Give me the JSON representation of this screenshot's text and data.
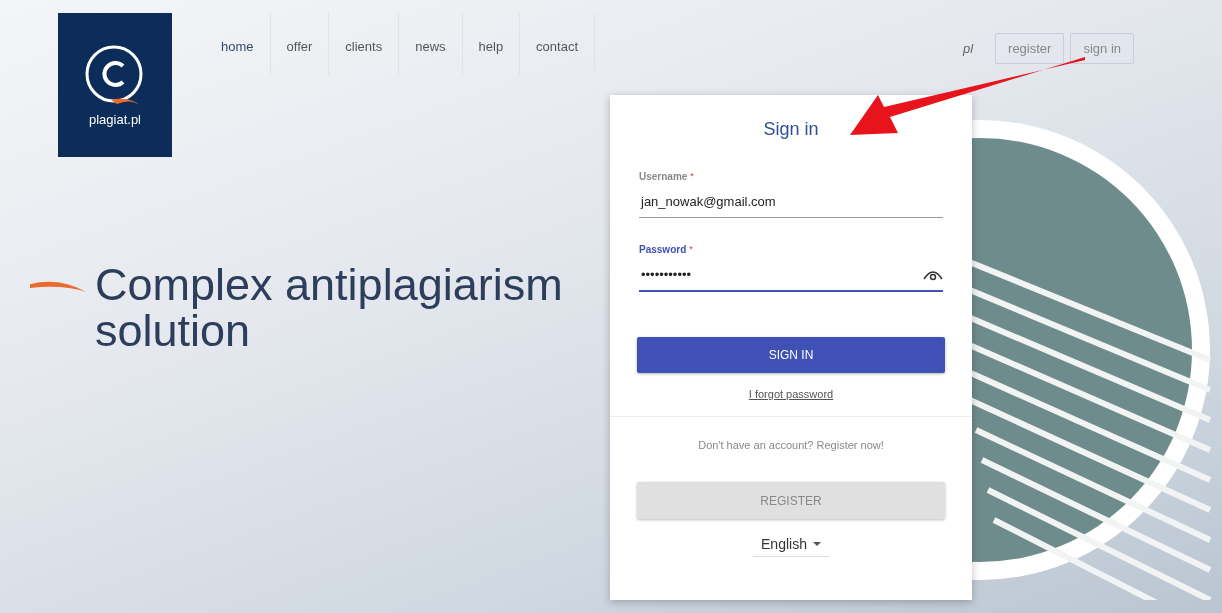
{
  "logo": {
    "text": "plagiat.pl"
  },
  "nav": [
    {
      "label": "home",
      "selected": true
    },
    {
      "label": "offer",
      "selected": false
    },
    {
      "label": "clients",
      "selected": false
    },
    {
      "label": "news",
      "selected": false
    },
    {
      "label": "help",
      "selected": false
    },
    {
      "label": "contact",
      "selected": false
    }
  ],
  "header_actions": {
    "language": "pl",
    "buttons": [
      "register",
      "sign in"
    ]
  },
  "hero": {
    "headline": "Complex antiplagiarism solution"
  },
  "sign_in_card": {
    "title": "Sign in",
    "fields": [
      {
        "label": "Username",
        "required_mark": "*",
        "value": "jan_nowak@gmail.com",
        "focused": false,
        "kind": "text"
      },
      {
        "label": "Password",
        "required_mark": "*",
        "value": "•••••••••••",
        "focused": true,
        "kind": "password"
      }
    ],
    "submit": "SIGN IN",
    "forgot_link": "I forgot password",
    "register_prompt": "Don't have an account? Register now!",
    "register_button": "REGISTER",
    "language_select": "English"
  }
}
